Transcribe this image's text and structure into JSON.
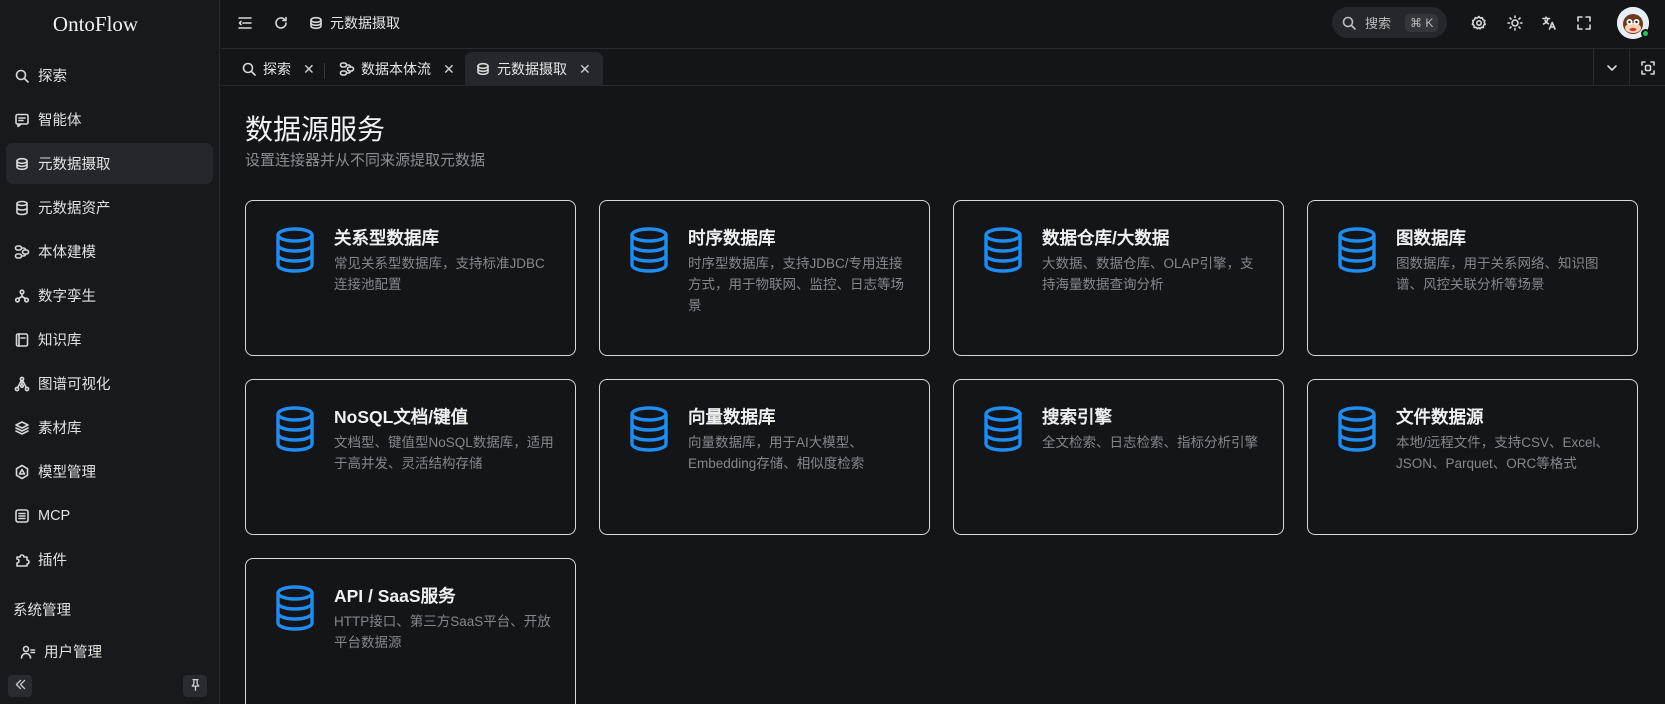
{
  "app": {
    "logo": "OntoFlow"
  },
  "sidebar": {
    "items": [
      {
        "label": "探索",
        "icon": "search-icon",
        "active": false
      },
      {
        "label": "智能体",
        "icon": "message-icon",
        "active": false
      },
      {
        "label": "元数据摄取",
        "icon": "stack-icon",
        "active": true
      },
      {
        "label": "元数据资产",
        "icon": "database-icon",
        "active": false
      },
      {
        "label": "本体建模",
        "icon": "flow-icon",
        "active": false
      },
      {
        "label": "数字孪生",
        "icon": "nodes-icon",
        "active": false
      },
      {
        "label": "知识库",
        "icon": "book-icon",
        "active": false
      },
      {
        "label": "图谱可视化",
        "icon": "graph-icon",
        "active": false
      },
      {
        "label": "素材库",
        "icon": "layers-icon",
        "active": false
      },
      {
        "label": "模型管理",
        "icon": "model-icon",
        "active": false
      },
      {
        "label": "MCP",
        "icon": "mcp-icon",
        "active": false
      },
      {
        "label": "插件",
        "icon": "puzzle-icon",
        "active": false
      }
    ],
    "section_label": "系统管理",
    "bottom_item": {
      "label": "用户管理",
      "icon": "users-icon"
    }
  },
  "header": {
    "breadcrumb": "元数据摄取",
    "search_placeholder": "搜索",
    "search_shortcut": "⌘ K"
  },
  "tabs": [
    {
      "label": "探索",
      "icon": "search-icon",
      "active": false
    },
    {
      "label": "数据本体流",
      "icon": "flow-icon",
      "active": false
    },
    {
      "label": "元数据摄取",
      "icon": "stack-icon",
      "active": true
    }
  ],
  "main": {
    "title": "数据源服务",
    "subtitle": "设置连接器并从不同来源提取元数据",
    "cards": [
      {
        "title": "关系型数据库",
        "desc": "常见关系型数据库，支持标准JDBC连接池配置"
      },
      {
        "title": "时序数据库",
        "desc": "时序型数据库，支持JDBC/专用连接方式，用于物联网、监控、日志等场景"
      },
      {
        "title": "数据仓库/大数据",
        "desc": "大数据、数据仓库、OLAP引擎，支持海量数据查询分析"
      },
      {
        "title": "图数据库",
        "desc": "图数据库，用于关系网络、知识图谱、风控关联分析等场景"
      },
      {
        "title": "NoSQL文档/键值",
        "desc": "文档型、键值型NoSQL数据库，适用于高并发、灵活结构存储"
      },
      {
        "title": "向量数据库",
        "desc": "向量数据库，用于AI大模型、Embedding存储、相似度检索"
      },
      {
        "title": "搜索引擎",
        "desc": "全文检索、日志检索、指标分析引擎"
      },
      {
        "title": "文件数据源",
        "desc": "本地/远程文件，支持CSV、Excel、JSON、Parquet、ORC等格式"
      },
      {
        "title": "API / SaaS服务",
        "desc": "HTTP接口、第三方SaaS平台、开放平台数据源"
      }
    ]
  },
  "colors": {
    "accent": "#1e8cf0",
    "status_online": "#22c55e"
  }
}
